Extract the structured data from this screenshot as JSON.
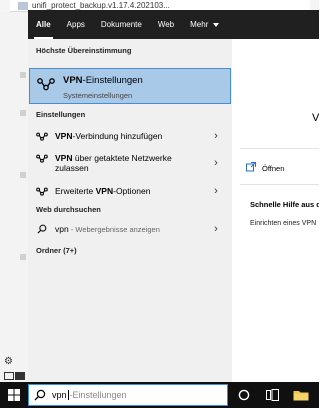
{
  "background_app": {
    "file_name": "unifi_protect_backup.v1.17.4.202103..."
  },
  "tabs": [
    {
      "label": "Alle",
      "active": true
    },
    {
      "label": "Apps"
    },
    {
      "label": "Dokumente"
    },
    {
      "label": "Web"
    },
    {
      "label": "Mehr"
    }
  ],
  "sections": {
    "best_match": "Höchste Übereinstimmung",
    "settings": "Einstellungen",
    "web": "Web durchsuchen",
    "folders": "Ordner (7+)"
  },
  "best_match_item": {
    "title_bold": "VPN",
    "title_rest": "-Einstellungen",
    "subtitle": "Systemeinstellungen",
    "icon": "vpn-icon"
  },
  "settings_items": [
    {
      "bold": "VPN",
      "rest": "-Verbindung hinzufügen"
    },
    {
      "bold": "VPN",
      "rest": " über getaktete Netzwerke",
      "line2": "zulassen"
    },
    {
      "pre": "Erweiterte ",
      "bold": "VPN",
      "rest": "-Optionen"
    }
  ],
  "web_item": {
    "query": "vpn",
    "suffix": " - Webergebnisse anzeigen"
  },
  "right_pane": {
    "letter": "V",
    "open_label": "Öffnen",
    "help_title": "Schnelle Hilfe aus de",
    "help_item": "Einrichten eines VPN"
  },
  "search": {
    "query": "vpn",
    "hint": "-Einstellungen"
  },
  "colors": {
    "accent": "#3b8ee6",
    "selected_bg": "#a8c9e8",
    "tab_bar": "#202020",
    "taskbar": "#101010"
  }
}
